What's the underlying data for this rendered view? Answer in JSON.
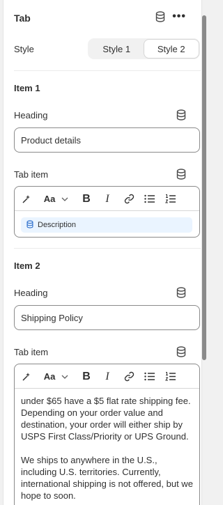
{
  "header": {
    "title": "Tab",
    "more_label": "•••"
  },
  "style_setting": {
    "label": "Style",
    "options": [
      "Style 1",
      "Style 2"
    ],
    "selected": "Style 2"
  },
  "items": [
    {
      "section_label": "Item 1",
      "heading_label": "Heading",
      "heading_value": "Product details",
      "tab_item_label": "Tab item",
      "content_chip": "Description"
    },
    {
      "section_label": "Item 2",
      "heading_label": "Heading",
      "heading_value": "Shipping Policy",
      "tab_item_label": "Tab item",
      "content_paragraphs": [
        "under $65 have a $5 flat rate shipping fee. Depending on your order value and destination, your order will either ship by USPS First Class/Priority or UPS Ground.",
        "We ships to anywhere in the U.S., including U.S. territories. Currently, international shipping is not offered, but we hope to soon."
      ]
    }
  ],
  "toolbar": {
    "font_label": "Aa",
    "bold_label": "B",
    "italic_label": "I"
  },
  "icons": [
    "database-icon",
    "more-icon",
    "magic-icon",
    "chevron-down-icon",
    "link-icon",
    "bullet-list-icon",
    "numbered-list-icon"
  ],
  "colors": {
    "chip_bg": "#eaf4ff",
    "border": "#8a8a8a",
    "panel_bg": "#ffffff"
  }
}
